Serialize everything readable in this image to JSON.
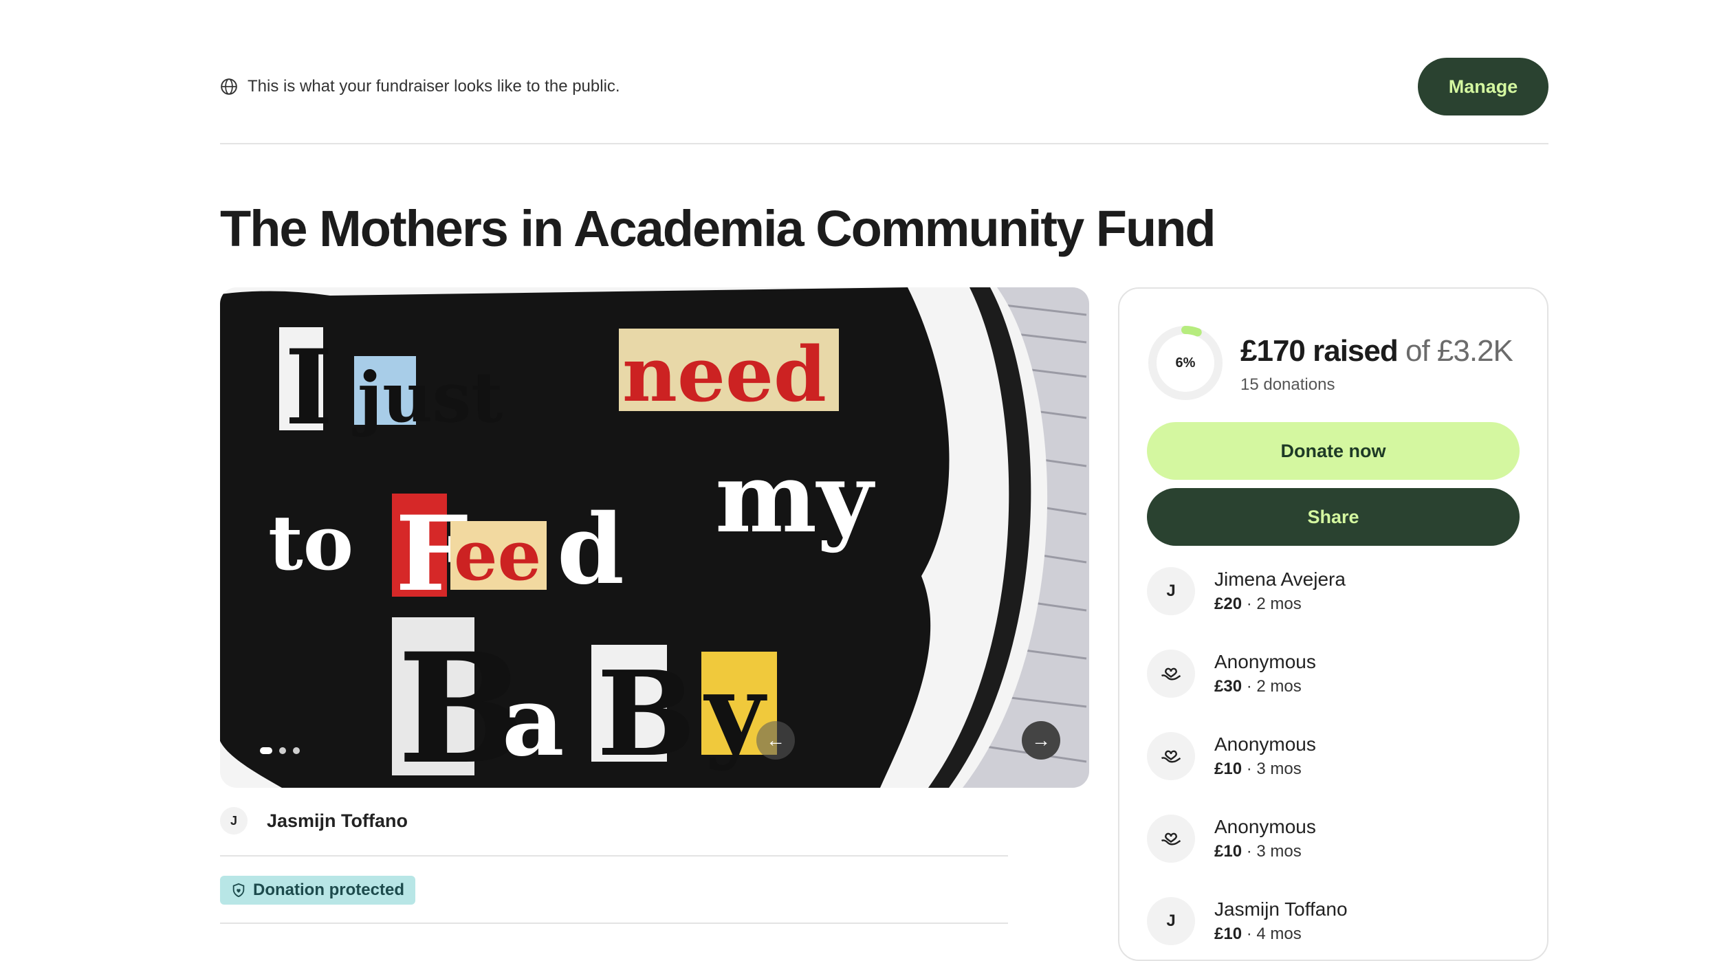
{
  "banner": {
    "public_note": "This is what your fundraiser looks like to the public.",
    "manage_label": "Manage"
  },
  "fundraiser": {
    "title": "The Mothers in Academia Community Fund",
    "image_words": [
      "I",
      "just",
      "need",
      "to",
      "Feed",
      "my",
      "BaBy"
    ],
    "organizer_initial": "J",
    "organizer_name": "Jasmijn Toffano",
    "protected_label": "Donation protected"
  },
  "stats": {
    "percent": "6%",
    "progress_fraction": 0.06,
    "raised_amount": "£170 raised",
    "goal_text": "of £3.2K",
    "donations_count": "15 donations"
  },
  "actions": {
    "donate_label": "Donate now",
    "share_label": "Share"
  },
  "donors": [
    {
      "initial": "J",
      "icon": null,
      "name": "Jimena Avejera",
      "amount": "£20",
      "when": " · 2 mos"
    },
    {
      "initial": "",
      "icon": "heart-hand-icon",
      "name": "Anonymous",
      "amount": "£30",
      "when": " · 2 mos"
    },
    {
      "initial": "",
      "icon": "heart-hand-icon",
      "name": "Anonymous",
      "amount": "£10",
      "when": " · 3 mos"
    },
    {
      "initial": "",
      "icon": "heart-hand-icon",
      "name": "Anonymous",
      "amount": "£10",
      "when": " · 3 mos"
    },
    {
      "initial": "J",
      "icon": null,
      "name": "Jasmijn Toffano",
      "amount": "£10",
      "when": " · 4 mos"
    }
  ],
  "colors": {
    "brand_dark": "#2a4230",
    "brand_light": "#d4f7a0",
    "badge_bg": "#b8e6e6"
  }
}
